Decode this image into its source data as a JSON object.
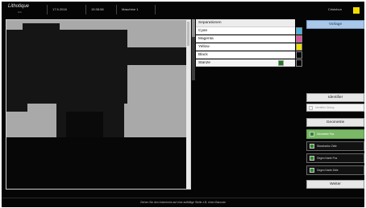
{
  "topbar": {
    "app_name": "Lithotique",
    "app_subtitle": "AG",
    "date": "17.5.2016",
    "time": "15:38:58",
    "machine": "Maschine 1",
    "user": "Cristobun",
    "user_color": "#f2dd00"
  },
  "separations": {
    "header": "Separationen",
    "items": [
      {
        "label": "Cyan",
        "color": "#45b3e0"
      },
      {
        "label": "Magenta",
        "color": "#e0529b"
      },
      {
        "label": "Yellow",
        "color": "#f2dd00"
      },
      {
        "label": "Black",
        "color": "#050505"
      },
      {
        "label": "Stanze",
        "color": "#050505",
        "selected": true
      }
    ]
  },
  "panel": {
    "preview_button": "Vorlage",
    "identifier_button": "Identifier",
    "identifier_placeholder": "Identifier Dialog",
    "geometry_button": "Geometrie",
    "geometry_options": [
      {
        "label": "Geometrie Pos",
        "active": true
      },
      {
        "label": "Stanzkontur Zeile",
        "active": false
      },
      {
        "label": "Gegen Kante Pos",
        "active": false
      },
      {
        "label": "Gegen Kante Zeile",
        "active": false
      }
    ],
    "next_button": "Weiter"
  },
  "status": {
    "message": "Ziehen Sie den Ankerkreis auf eine auffällige Stelle z.B. einen Barcode"
  }
}
